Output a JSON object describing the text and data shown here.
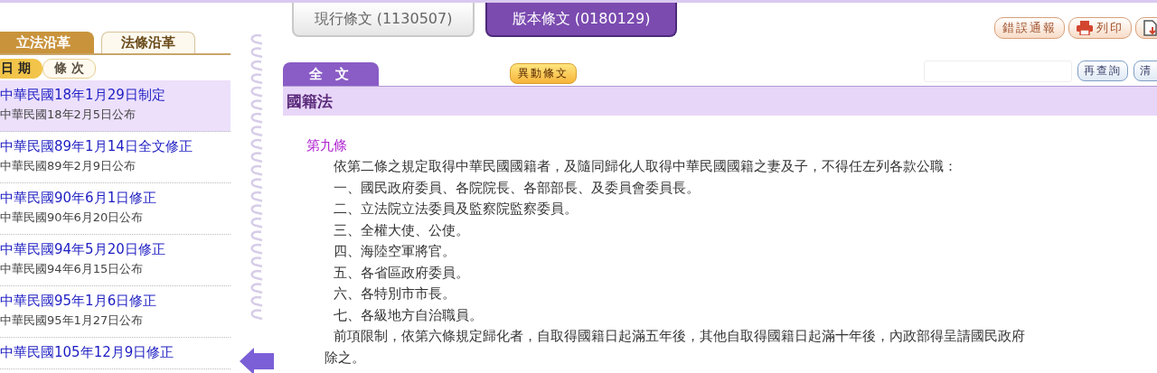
{
  "history_tabs": [
    {
      "label": "立法沿革",
      "selected": true
    },
    {
      "label": "法條沿革",
      "selected": false
    }
  ],
  "sort_tabs": [
    {
      "label": "日 期",
      "selected": true
    },
    {
      "label": "條 次",
      "selected": false
    }
  ],
  "history_items": [
    {
      "title": "中華民國18年1月29日制定",
      "subtitle": "中華民國18年2月5日公布",
      "selected": true
    },
    {
      "title": "中華民國89年1月14日全文修正",
      "subtitle": "中華民國89年2月9日公布",
      "selected": false
    },
    {
      "title": "中華民國90年6月1日修正",
      "subtitle": "中華民國90年6月20日公布",
      "selected": false
    },
    {
      "title": "中華民國94年5月20日修正",
      "subtitle": "中華民國94年6月15日公布",
      "selected": false
    },
    {
      "title": "中華民國95年1月6日修正",
      "subtitle": "中華民國95年1月27日公布",
      "selected": false
    },
    {
      "title": "中華民國105年12月9日修正",
      "selected": false
    }
  ],
  "version_tabs": [
    {
      "label": "現行條文 (1130507)",
      "selected": false
    },
    {
      "label": "版本條文 (0180129)",
      "selected": true
    }
  ],
  "tool_buttons": [
    {
      "label": "錯誤通報",
      "kind": "text"
    },
    {
      "label": "列印",
      "kind": "print"
    },
    {
      "kind": "download"
    }
  ],
  "view_tabs": [
    {
      "label": "全 文",
      "selected": true
    }
  ],
  "changed_button": "異動條文",
  "search": {
    "button": "再查詢",
    "clear": "清"
  },
  "law_title": "國籍法",
  "article": {
    "number": "第九條",
    "paragraphs": [
      {
        "lines": [
          "依第二條之規定取得中華民國國籍者，及隨同歸化人取得中華民國國籍之妻及子，不得任左列各款公職："
        ]
      },
      {
        "lines": [
          "一、國民政府委員、各院院長、各部部長、及委員會委員長。"
        ]
      },
      {
        "lines": [
          "二、立法院立法委員及監察院監察委員。"
        ]
      },
      {
        "lines": [
          "三、全權大使、公使。"
        ]
      },
      {
        "lines": [
          "四、海陸空軍將官。"
        ]
      },
      {
        "lines": [
          "五、各省區政府委員。"
        ]
      },
      {
        "lines": [
          "六、各特別市市長。"
        ]
      },
      {
        "lines": [
          "七、各級地方自治職員。"
        ]
      },
      {
        "lines": [
          "前項限制，依第六條規定歸化者，自取得國籍日起滿五年後，其他自取得國籍日起滿十年後，內政部得呈請國民政府",
          "除之。"
        ]
      }
    ]
  }
}
